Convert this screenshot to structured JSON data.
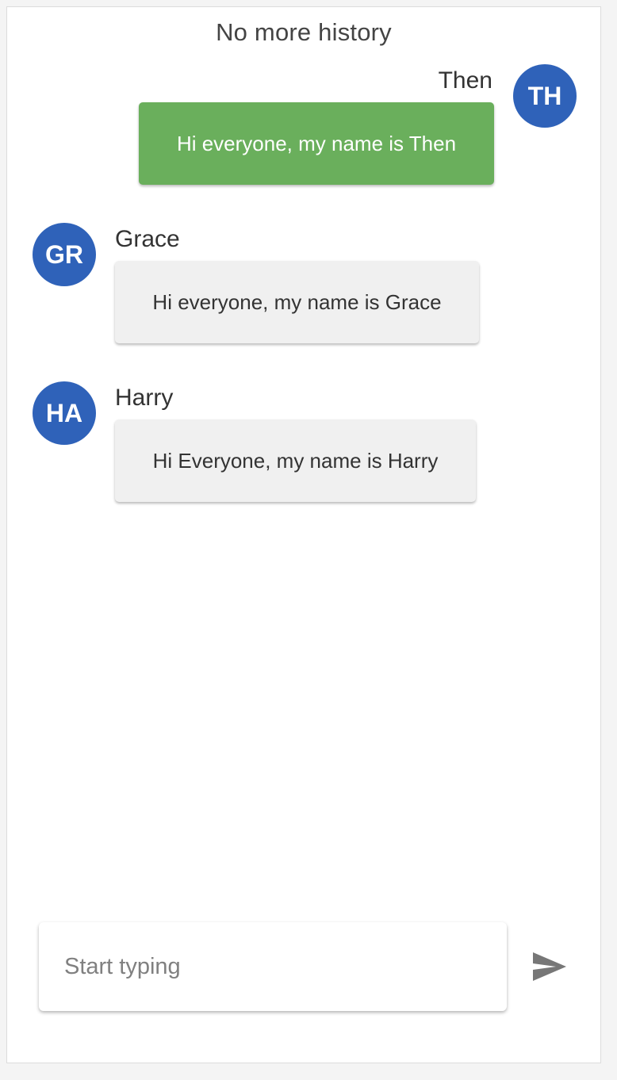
{
  "history_note": "No more history",
  "messages": [
    {
      "initials": "TH",
      "name": "Then",
      "text": "Hi everyone, my name is Then",
      "own": true,
      "avatar_color": "#2f62b9",
      "bubble_color": "#6aaf5c"
    },
    {
      "initials": "GR",
      "name": "Grace",
      "text": "Hi everyone, my name is Grace",
      "own": false,
      "avatar_color": "#2f62b9",
      "bubble_color": "#f0f0f0"
    },
    {
      "initials": "HA",
      "name": "Harry",
      "text": "Hi Everyone, my name is Harry",
      "own": false,
      "avatar_color": "#2f62b9",
      "bubble_color": "#f0f0f0"
    }
  ],
  "composer": {
    "placeholder": "Start typing",
    "value": ""
  },
  "send_icon": "send-icon",
  "send_icon_color": "#777777"
}
